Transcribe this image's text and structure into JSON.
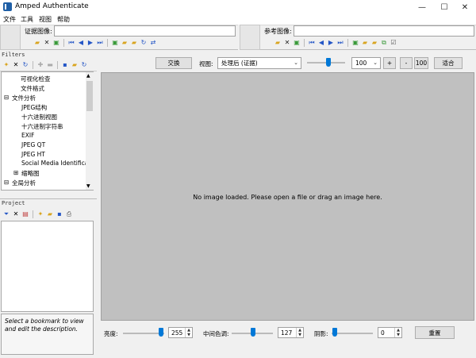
{
  "window": {
    "title": "Amped Authenticate",
    "minimize": "—",
    "maximize": "☐",
    "close": "✕"
  },
  "menu": [
    "文件",
    "工具",
    "视图",
    "帮助"
  ],
  "evidence": {
    "label": "证据图像:",
    "value": ""
  },
  "reference": {
    "label": "参考图像:",
    "value": ""
  },
  "filters": {
    "header": "Filters",
    "tree": [
      {
        "label": "可视化检查",
        "level": 2
      },
      {
        "label": "文件格式",
        "level": 2
      },
      {
        "label": "文件分析",
        "level": 1,
        "expander": "⊟"
      },
      {
        "label": "JPEG结构",
        "level": 2
      },
      {
        "label": "十六进制视图",
        "level": 2
      },
      {
        "label": "十六进制字符串",
        "level": 2
      },
      {
        "label": "EXIF",
        "level": 2
      },
      {
        "label": "JPEG QT",
        "level": 2
      },
      {
        "label": "JPEG HT",
        "level": 2
      },
      {
        "label": "Social Media Identificat",
        "level": 2
      },
      {
        "label": "缩略图",
        "level": 2,
        "expander": "⊞"
      },
      {
        "label": "全局分析",
        "level": 1,
        "expander": "⊟"
      }
    ]
  },
  "project": {
    "header": "Project",
    "description_hint": "Select a bookmark to view and edit the description."
  },
  "toolbar": {
    "swap_label": "交换",
    "view_label": "视图:",
    "view_value": "处理后 (证据)",
    "zoom_value": "100",
    "zoom_in": "+",
    "zoom_out": "-",
    "zoom_100": "100",
    "fit_label": "适合"
  },
  "viewer": {
    "message": "No image loaded. Please open a file or drag an image here."
  },
  "adjust": {
    "brightness_label": "亮度:",
    "brightness_value": "255",
    "midtone_label": "中间色调:",
    "midtone_value": "127",
    "shadow_label": "阴影:",
    "shadow_value": "0",
    "reset_label": "重置"
  },
  "colors": {
    "accent": "#0078d7",
    "viewer_bg": "#c0c0c0"
  }
}
